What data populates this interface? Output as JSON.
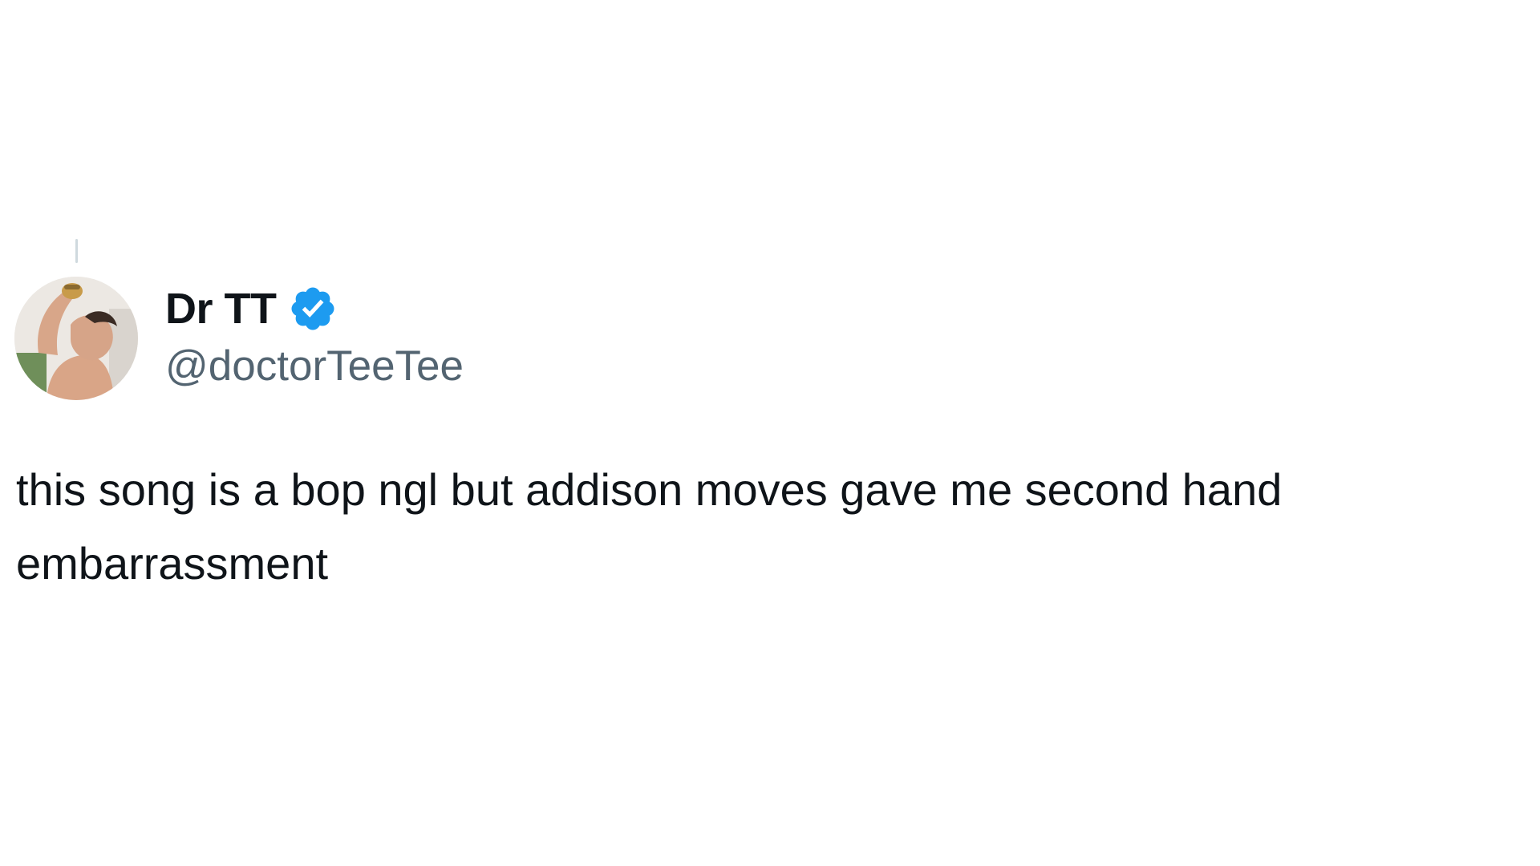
{
  "tweet": {
    "author": {
      "display_name": "Dr TT",
      "handle": "@doctorTeeTee",
      "verified": true,
      "verified_icon": "verified-badge-icon",
      "avatar_icon": "profile-photo"
    },
    "text": "this song is a bop ngl but addison moves gave me second hand embarrassment"
  },
  "colors": {
    "background": "#ffffff",
    "text_primary": "#0f1419",
    "text_secondary": "#536471",
    "verified_blue": "#1d9bf0",
    "thread_line": "#cfd9de"
  }
}
